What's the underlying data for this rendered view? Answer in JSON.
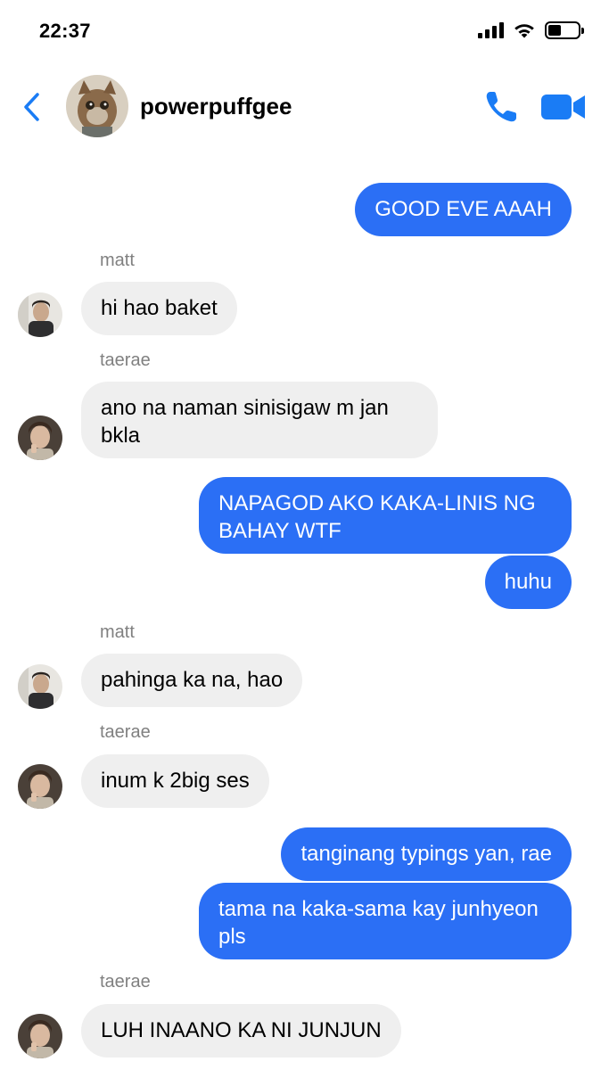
{
  "status_bar": {
    "time": "22:37",
    "icons": [
      "cellular-signal-icon",
      "wifi-icon",
      "battery-icon"
    ],
    "battery_level": 0.45
  },
  "header": {
    "back_icon": "chevron-left-icon",
    "contact_name": "powerpuffgee",
    "call_icon": "phone-icon",
    "video_icon": "video-camera-icon"
  },
  "colors": {
    "accent": "#1a7cf5",
    "outgoing_bubble": "#2b6ff5",
    "incoming_bubble": "#efefef",
    "sender_label": "#808080"
  },
  "messages": [
    {
      "direction": "out",
      "text": "GOOD EVE AAAH"
    },
    {
      "direction": "in",
      "sender": "matt",
      "text": "hi hao baket"
    },
    {
      "direction": "in",
      "sender": "taerae",
      "text": "ano na naman sinisigaw m jan bkla"
    },
    {
      "direction": "out",
      "text": "NAPAGOD AKO KAKA-LINIS NG BAHAY WTF"
    },
    {
      "direction": "out",
      "text": "huhu"
    },
    {
      "direction": "in",
      "sender": "matt",
      "text": "pahinga ka na, hao"
    },
    {
      "direction": "in",
      "sender": "taerae",
      "text": "inum k 2big ses"
    },
    {
      "direction": "out",
      "text": "tanginang typings yan, rae"
    },
    {
      "direction": "out",
      "text": "tama na kaka-sama kay junhyeon pls"
    },
    {
      "direction": "in",
      "sender": "taerae",
      "text": "LUH INAANO KA NI JUNJUN"
    }
  ]
}
